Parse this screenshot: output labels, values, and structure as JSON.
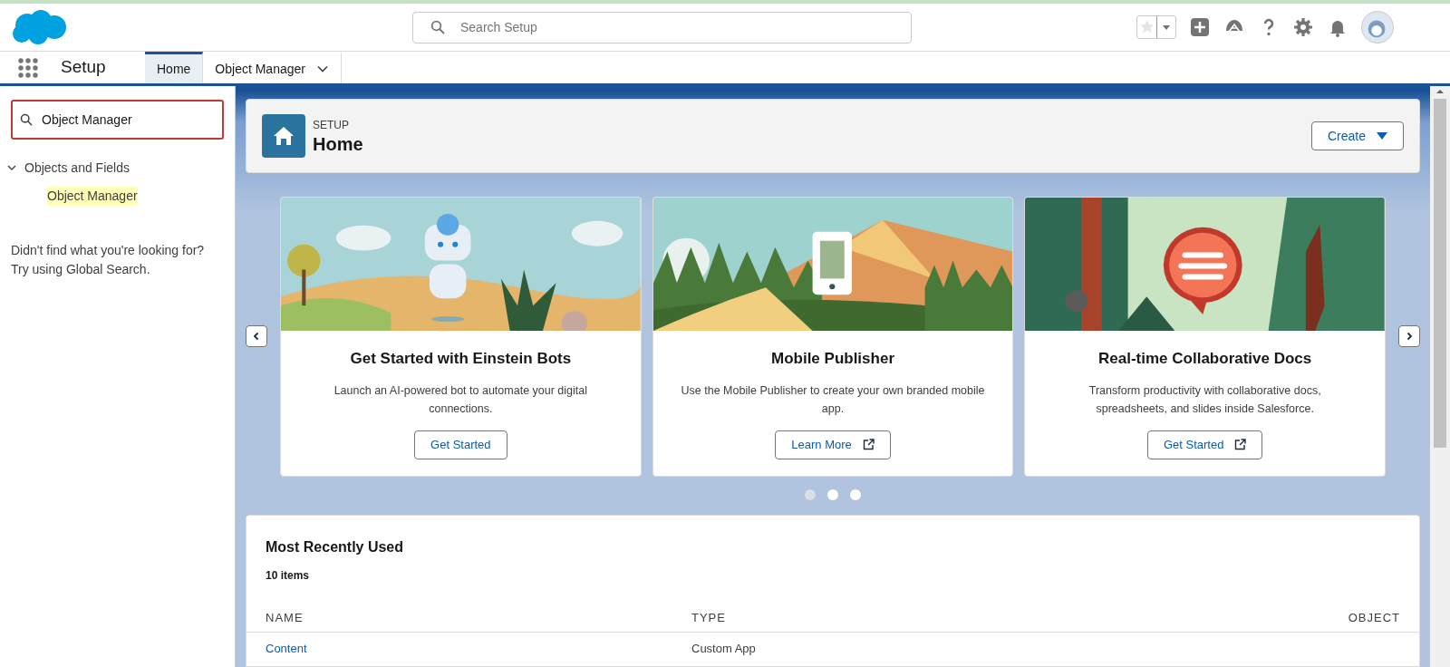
{
  "header": {
    "search_placeholder": "Search Setup"
  },
  "nav": {
    "app_name": "Setup",
    "tabs": [
      {
        "label": "Home",
        "selected": true,
        "has_menu": false
      },
      {
        "label": "Object Manager",
        "selected": false,
        "has_menu": true
      }
    ]
  },
  "sidebar": {
    "search_value": "Object Manager",
    "tree": [
      {
        "label": "Objects and Fields",
        "expanded": true,
        "children": [
          {
            "label": "Object Manager",
            "highlighted": true
          }
        ]
      }
    ],
    "hint_lines": [
      "Didn't find what you're looking for?",
      "Try using Global Search."
    ]
  },
  "page_header": {
    "eyebrow": "SETUP",
    "title": "Home",
    "action": "Create"
  },
  "carousel": {
    "cards": [
      {
        "kind": "bots",
        "title": "Get Started with Einstein Bots",
        "description": "Launch an AI-powered bot to automate your digital connections.",
        "button": "Get Started",
        "external": false
      },
      {
        "kind": "mobile",
        "title": "Mobile Publisher",
        "description": "Use the Mobile Publisher to create your own branded mobile app.",
        "button": "Learn More",
        "external": true
      },
      {
        "kind": "docs",
        "title": "Real-time Collaborative Docs",
        "description": "Transform productivity with collaborative docs, spreadsheets, and slides inside Salesforce.",
        "button": "Get Started",
        "external": true
      }
    ],
    "dots": [
      {
        "selected": true
      },
      {
        "selected": false
      },
      {
        "selected": false
      }
    ]
  },
  "recent": {
    "title": "Most Recently Used",
    "count": "10 items",
    "columns": [
      "NAME",
      "TYPE",
      "OBJECT"
    ],
    "rows": [
      [
        "Content",
        "Custom App",
        ""
      ]
    ]
  }
}
